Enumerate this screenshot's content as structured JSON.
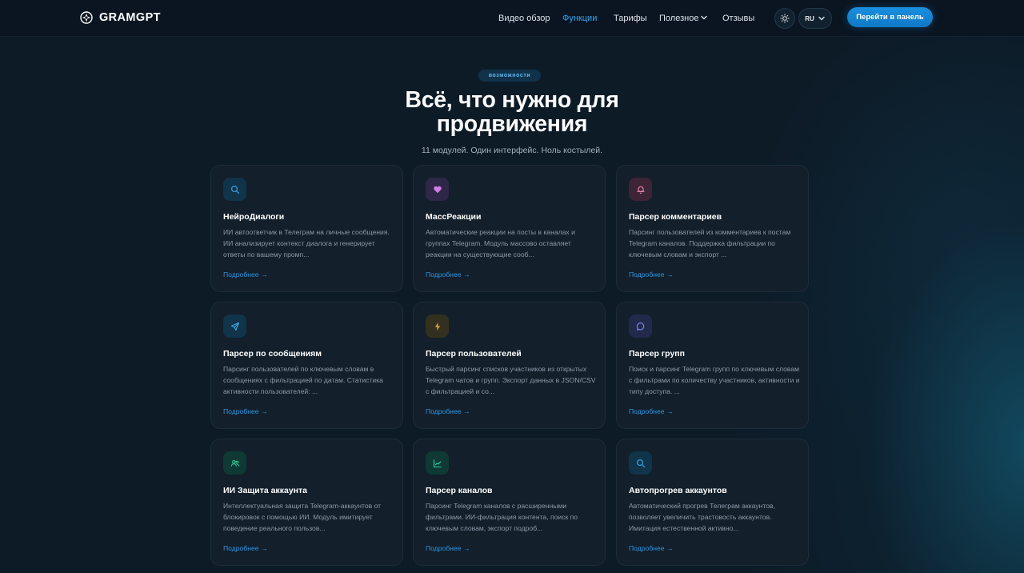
{
  "brand": {
    "name": "GRAMGPT"
  },
  "nav": {
    "links": [
      "Видео обзор",
      "Функции",
      "Тарифы",
      "Полезное",
      "Отзывы"
    ],
    "active": "Функции",
    "lang": "RU",
    "cta": "Перейти в панель"
  },
  "hero": {
    "badge": "возможности",
    "title": "Всё, что нужно для продвижения",
    "subtitle": "11 модулей. Один интерфейс. Ноль костылей."
  },
  "cards": [
    {
      "title": "НейроДиалоги",
      "desc": "ИИ автоответчик в Телеграм на личные сообщения. ИИ анализирует контекст диалога и генерирует ответы по вашему промп...",
      "more": "Подробнее →",
      "icon": "search-icon",
      "icon_color": "#3a9bd9",
      "icon_bg": "#10344a"
    },
    {
      "title": "МассРеакции",
      "desc": "Автоматические реакции на посты в каналах и группах Telegram. Модуль массово оставляет реакции на существующие сооб...",
      "more": "Подробнее →",
      "icon": "heart-icon",
      "icon_color": "#d17ee6",
      "icon_bg": "#2e2747"
    },
    {
      "title": "Парсер комментариев",
      "desc": "Парсинг пользователей из комментариев к постам Telegram каналов. Поддержка фильтрации по ключевым словам и экспорт ...",
      "more": "Подробнее →",
      "icon": "bell-icon",
      "icon_color": "#e78aa6",
      "icon_bg": "#3d2436"
    },
    {
      "title": "Парсер по сообщениям",
      "desc": "Парсинг пользователей по ключевым словам в сообщениях с фильтрацией по датам. Статистика активности пользователей: ...",
      "more": "Подробнее →",
      "icon": "send-icon",
      "icon_color": "#3aa9e0",
      "icon_bg": "#10344a"
    },
    {
      "title": "Парсер пользователей",
      "desc": "Быстрый парсинг списков участников из открытых Telegram чатов и групп. Экспорт данных в JSON/CSV с фильтрацией и со...",
      "more": "Подробнее →",
      "icon": "bolt-icon",
      "icon_color": "#e0a236",
      "icon_bg": "#33301f"
    },
    {
      "title": "Парсер групп",
      "desc": "Поиск и парсинг Telegram групп по ключевым словам с фильтрами по количеству участников, активности и типу доступа. ...",
      "more": "Подробнее →",
      "icon": "chat-icon",
      "icon_color": "#7f8cf0",
      "icon_bg": "#22294a"
    },
    {
      "title": "ИИ Защита аккаунта",
      "desc": "Интеллектуальная защита Telegram-аккаунтов от блокировок с помощью ИИ. Модуль имитирует поведение реального пользов...",
      "more": "Подробнее →",
      "icon": "users-icon",
      "icon_color": "#2fcf98",
      "icon_bg": "#0f3a34"
    },
    {
      "title": "Парсер каналов",
      "desc": "Парсинг Telegram каналов с расширенными фильтрами. ИИ-фильтрация контента, поиск по ключевым словам, экспорт подроб...",
      "more": "Подробнее →",
      "icon": "chart-icon",
      "icon_color": "#2fcf98",
      "icon_bg": "#0f3a34"
    },
    {
      "title": "Автопрогрев аккаунтов",
      "desc": "Автоматический прогрев Телеграм аккаунтов, позволяет увеличить трастовость аккаунтов. Имитация естественной активно...",
      "more": "Подробнее →",
      "icon": "search-icon",
      "icon_color": "#3a9bd9",
      "icon_bg": "#10344a"
    }
  ]
}
